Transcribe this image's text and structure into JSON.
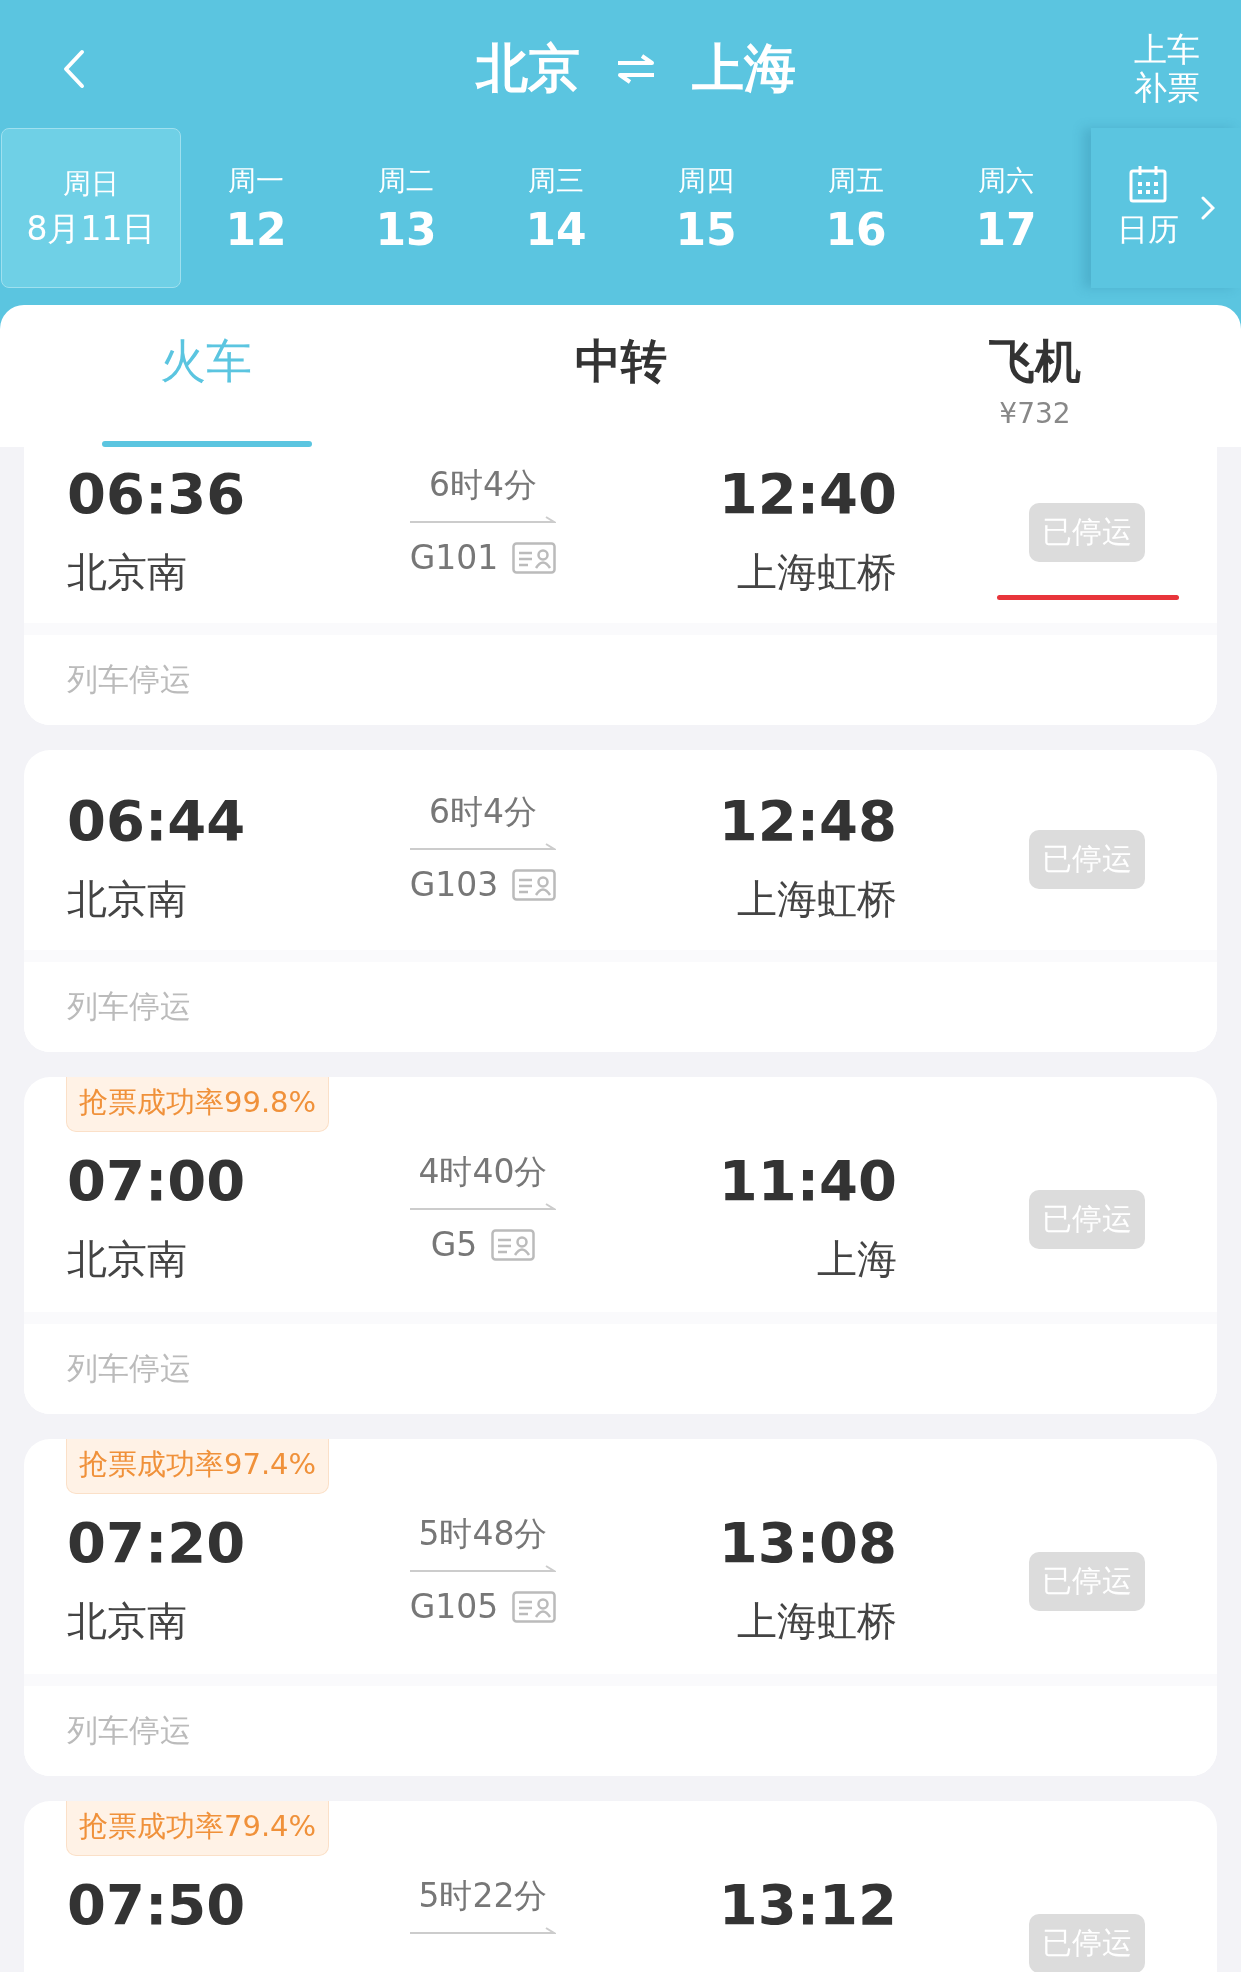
{
  "header": {
    "from": "北京",
    "to": "上海",
    "action": "上车补票"
  },
  "dates": [
    {
      "weekday": "周日",
      "date": "8月11日",
      "selected": true
    },
    {
      "weekday": "周一",
      "date": "12",
      "selected": false
    },
    {
      "weekday": "周二",
      "date": "13",
      "selected": false
    },
    {
      "weekday": "周三",
      "date": "14",
      "selected": false
    },
    {
      "weekday": "周四",
      "date": "15",
      "selected": false
    },
    {
      "weekday": "周五",
      "date": "16",
      "selected": false
    },
    {
      "weekday": "周六",
      "date": "17",
      "selected": false
    }
  ],
  "calendar": {
    "label": "日历"
  },
  "tabs": [
    {
      "label": "火车",
      "selected": true
    },
    {
      "label": "中转",
      "selected": false
    },
    {
      "label": "飞机",
      "selected": false,
      "price": "¥732"
    }
  ],
  "trains": [
    {
      "depart": "06:36",
      "from_station": "北京南",
      "duration": "6时4分",
      "train_no": "G101",
      "arrive": "12:40",
      "to_station": "上海虹桥",
      "status": "已停运",
      "note": "列车停运",
      "underlined": true
    },
    {
      "depart": "06:44",
      "from_station": "北京南",
      "duration": "6时4分",
      "train_no": "G103",
      "arrive": "12:48",
      "to_station": "上海虹桥",
      "status": "已停运",
      "note": "列车停运",
      "underlined": false
    },
    {
      "badge": "抢票成功率99.8%",
      "depart": "07:00",
      "from_station": "北京南",
      "duration": "4时40分",
      "train_no": "G5",
      "arrive": "11:40",
      "to_station": "上海",
      "status": "已停运",
      "note": "列车停运",
      "underlined": false
    },
    {
      "badge": "抢票成功率97.4%",
      "depart": "07:20",
      "from_station": "北京南",
      "duration": "5时48分",
      "train_no": "G105",
      "arrive": "13:08",
      "to_station": "上海虹桥",
      "status": "已停运",
      "note": "列车停运",
      "underlined": false
    },
    {
      "badge": "抢票成功率79.4%",
      "depart": "07:50",
      "duration": "5时22分",
      "arrive": "13:12",
      "status": "已停运",
      "underlined": false
    }
  ]
}
